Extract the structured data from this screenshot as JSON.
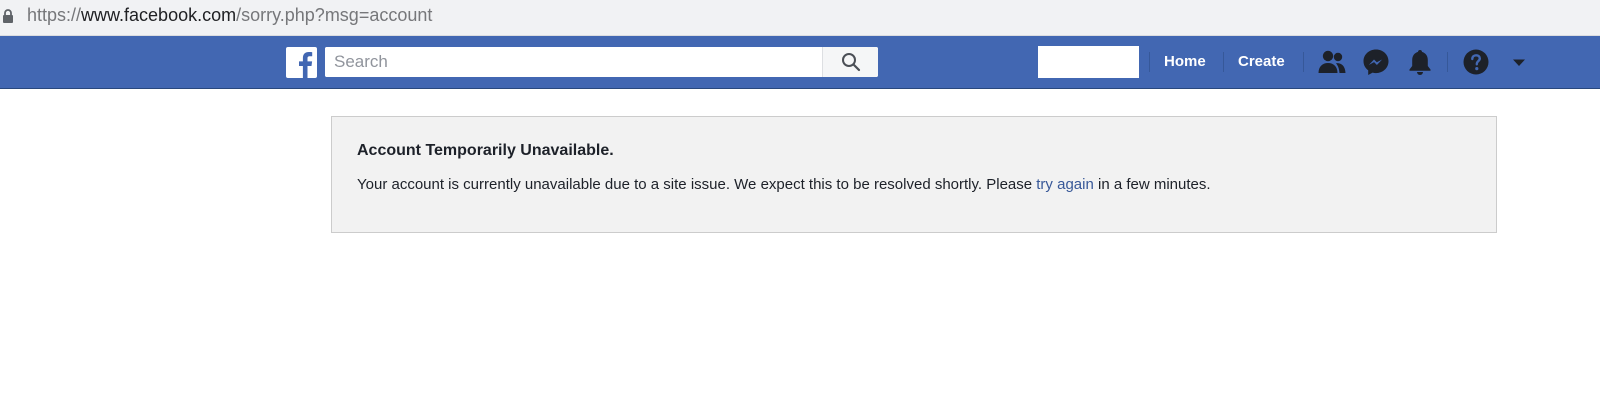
{
  "browser": {
    "url_prefix": "https://",
    "url_host": "www.facebook.com",
    "url_path": "/sorry.php?msg=account"
  },
  "header": {
    "search": {
      "placeholder": "Search"
    },
    "nav": {
      "home_label": "Home",
      "create_label": "Create"
    },
    "icons": [
      "facebook-logo-icon",
      "search-icon",
      "friends-icon",
      "messenger-icon",
      "notifications-bell-icon",
      "help-icon",
      "dropdown-caret-icon"
    ],
    "colors": {
      "bar": "#4267b2",
      "icon": "#1d2129"
    }
  },
  "error": {
    "title": "Account Temporarily Unavailable.",
    "message_before": "Your account is currently unavailable due to a site issue. We expect this to be resolved shortly. Please ",
    "link_text": "try again",
    "message_after": " in a few minutes."
  },
  "colors": {
    "link": "#385898",
    "box_background": "#f2f2f2"
  }
}
